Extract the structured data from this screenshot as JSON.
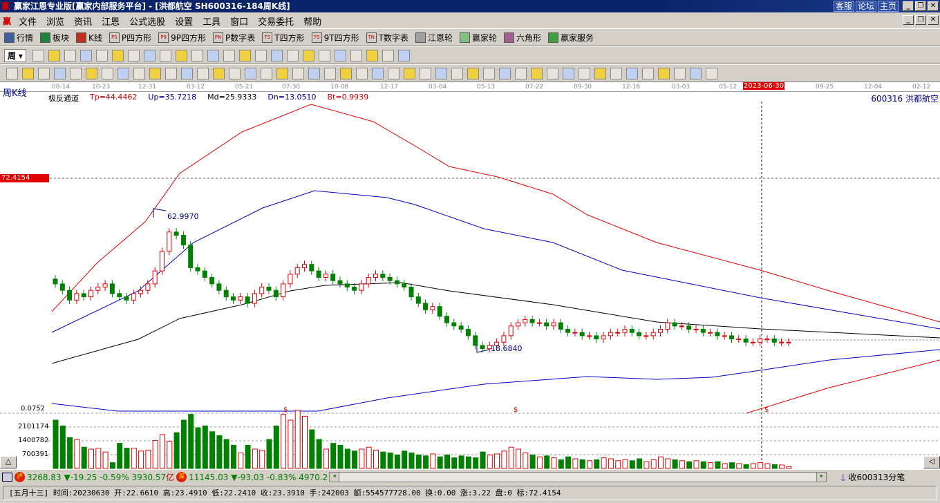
{
  "title": "赢家江恩专业版[赢家内部服务平台] - [洪都航空   SH600316-184周K线]",
  "title_links": [
    "客服",
    "论坛",
    "主页"
  ],
  "menu": [
    "文件",
    "浏览",
    "资讯",
    "江恩",
    "公式选股",
    "设置",
    "工具",
    "窗口",
    "交易委托",
    "帮助"
  ],
  "toolbar1": [
    {
      "icon": "grid-icon",
      "label": "行情"
    },
    {
      "icon": "blocks-icon",
      "label": "板块"
    },
    {
      "icon": "kline-icon",
      "label": "K线"
    },
    {
      "icon": "PS",
      "label": "P四方形"
    },
    {
      "icon": "P9",
      "label": "9P四方形"
    },
    {
      "icon": "PN",
      "label": "P数字表"
    },
    {
      "icon": "TS",
      "label": "T四方形"
    },
    {
      "icon": "T9",
      "label": "9T四方形"
    },
    {
      "icon": "TN",
      "label": "T数字表"
    },
    {
      "icon": "wheel-icon",
      "label": "江恩轮"
    },
    {
      "icon": "wheel-icon",
      "label": "赢家轮"
    },
    {
      "icon": "hexagon-icon",
      "label": "六角形"
    },
    {
      "icon": "service-icon",
      "label": "赢家服务"
    }
  ],
  "period_select": "周",
  "chart": {
    "period_label": "周K线",
    "date_ticks": [
      "08-14",
      "10-23",
      "12-31",
      "03-12",
      "05-21",
      "07-30",
      "10-08",
      "12-17",
      "03-04",
      "05-13",
      "07-22",
      "09-30",
      "12-16",
      "03-03",
      "05-12",
      "2023-06-30",
      "09-25",
      "12-04",
      "02-12"
    ],
    "indicator": {
      "name": "极反通道",
      "tp": "Tp=44.4462",
      "up": "Up=35.7218",
      "md": "Md=25.9333",
      "dn": "Dn=13.0510",
      "bt": "Bt=0.9939"
    },
    "stock": "600316  洪都航空",
    "price_marker": "72.4154",
    "high_label": "62.9970",
    "low_label": "18.6840",
    "sub_value": "0.0752",
    "vol_ticks": [
      "2101174",
      "1400782",
      "700391"
    ],
    "closes": [
      40,
      38,
      35,
      37,
      36,
      38,
      39,
      40,
      37,
      36,
      35,
      37,
      38,
      40,
      44,
      50,
      56,
      55,
      52,
      45,
      44,
      42,
      40,
      38,
      36,
      35,
      36,
      34,
      37,
      39,
      38,
      36,
      40,
      43,
      45,
      46,
      44,
      42,
      43,
      41,
      40,
      39,
      38,
      40,
      42,
      43,
      42,
      41,
      40,
      39,
      36,
      34,
      32,
      33,
      30,
      28,
      27,
      26,
      24,
      21,
      20,
      21,
      22,
      24,
      27,
      28,
      29,
      28,
      28,
      27,
      28,
      26,
      25,
      25,
      24,
      24,
      23,
      24,
      25,
      25,
      26,
      25,
      24,
      24,
      25,
      26,
      28,
      27,
      27,
      26,
      26,
      25,
      25,
      24,
      24,
      23,
      23,
      22,
      22,
      23,
      23,
      22,
      22,
      22
    ],
    "volumes": [
      250,
      220,
      160,
      150,
      110,
      100,
      105,
      85,
      30,
      130,
      105,
      105,
      90,
      95,
      145,
      175,
      140,
      185,
      250,
      280,
      210,
      220,
      190,
      170,
      150,
      120,
      80,
      120,
      100,
      95,
      150,
      220,
      280,
      250,
      300,
      270,
      200,
      150,
      100,
      130,
      120,
      100,
      90,
      100,
      110,
      95,
      85,
      80,
      70,
      90,
      80,
      70,
      65,
      75,
      60,
      70,
      55,
      65,
      60,
      55,
      85,
      70,
      75,
      90,
      110,
      100,
      80,
      70,
      60,
      65,
      55,
      45,
      60,
      50,
      45,
      40,
      45,
      55,
      50,
      40,
      45,
      40,
      50,
      35,
      45,
      60,
      50,
      45,
      40,
      35,
      40,
      35,
      30,
      35,
      25,
      30,
      25,
      20,
      25,
      30,
      25,
      20,
      18,
      10
    ]
  },
  "index_bar": {
    "sh_label": "沪",
    "sh": "3268.83",
    "sh_chg": "▼-19.25",
    "sh_pct": "-0.59%",
    "sh_amt": "3930.57",
    "unit": "亿",
    "sz_label": "深",
    "sz": "11145.03",
    "sz_chg": "▼-93.03",
    "sz_pct": "-0.83%",
    "sz_amt": "4970.2",
    "recv": "收600313分笔"
  },
  "info_line": "[五月十三] 时间:20230630 开:22.6610 高:23.4910 低:22.2410 收:23.3910 手:242003 额:554577728.00 换:0.00 涨:3.22 盘:0 标:72.4154"
}
